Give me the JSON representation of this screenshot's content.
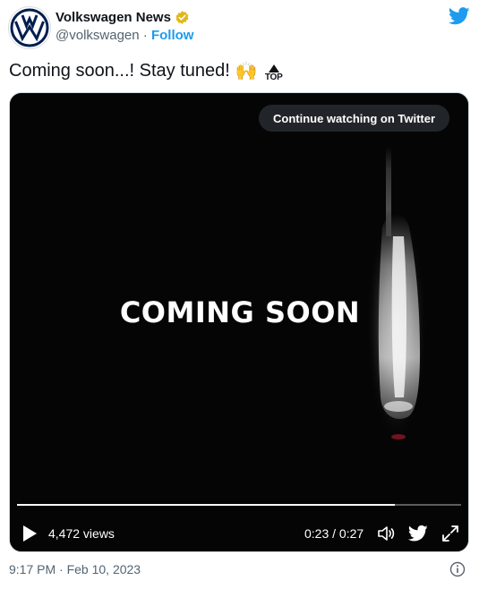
{
  "account": {
    "name": "Volkswagen News",
    "handle": "@volkswagen",
    "separator": "·",
    "follow_label": "Follow",
    "verified": true,
    "badge_color": "#e2b719"
  },
  "tweet": {
    "text": "Coming soon...! Stay tuned!",
    "emoji_hands": "🙌",
    "emoji_top_label": "TOP",
    "timestamp": "9:17 PM · Feb 10, 2023"
  },
  "video": {
    "overlay_text": "COMING SOON",
    "continue_label": "Continue watching on Twitter",
    "views": "4,472 views",
    "time": "0:23 / 0:27",
    "progress": 0.85
  },
  "colors": {
    "accent": "#1d9bf0",
    "text_secondary": "#536471",
    "vw_navy": "#001e50"
  },
  "icons": [
    "vw-logo-icon",
    "verified-badge-icon",
    "twitter-bird-icon",
    "play-icon",
    "volume-icon",
    "twitter-icon",
    "fullscreen-icon",
    "info-icon"
  ]
}
